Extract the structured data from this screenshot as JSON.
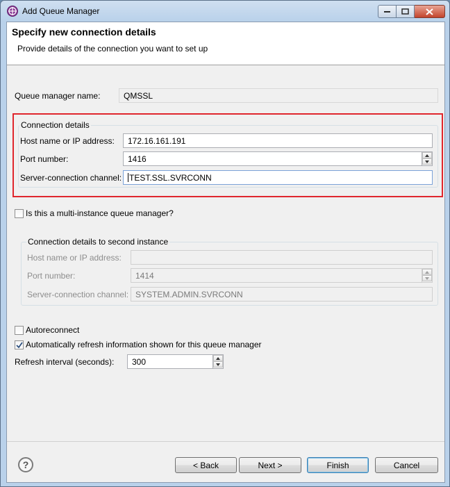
{
  "window": {
    "title": "Add Queue Manager"
  },
  "header": {
    "title": "Specify new connection details",
    "description": "Provide details of the connection you want to set up"
  },
  "queue_manager": {
    "label": "Queue manager name:",
    "value": "QMSSL"
  },
  "connection": {
    "group_title": "Connection details",
    "host_label": "Host name or IP address:",
    "host_value": "172.16.161.191",
    "port_label": "Port number:",
    "port_value": "1416",
    "channel_label": "Server-connection channel:",
    "channel_value": "TEST.SSL.SVRCONN"
  },
  "multi_instance": {
    "label": "Is this a multi-instance queue manager?",
    "checked": false
  },
  "second_instance": {
    "group_title": "Connection details to second instance",
    "host_label": "Host name or IP address:",
    "host_value": "",
    "port_label": "Port number:",
    "port_value": "1414",
    "channel_label": "Server-connection channel:",
    "channel_value": "SYSTEM.ADMIN.SVRCONN"
  },
  "options": {
    "autoreconnect_label": "Autoreconnect",
    "autoreconnect_checked": false,
    "auto_refresh_label": "Automatically refresh information shown for this queue manager",
    "auto_refresh_checked": true,
    "refresh_interval_label": "Refresh interval (seconds):",
    "refresh_interval_value": "300"
  },
  "buttons": {
    "back": "< Back",
    "next": "Next >",
    "finish": "Finish",
    "cancel": "Cancel",
    "help": "?"
  }
}
